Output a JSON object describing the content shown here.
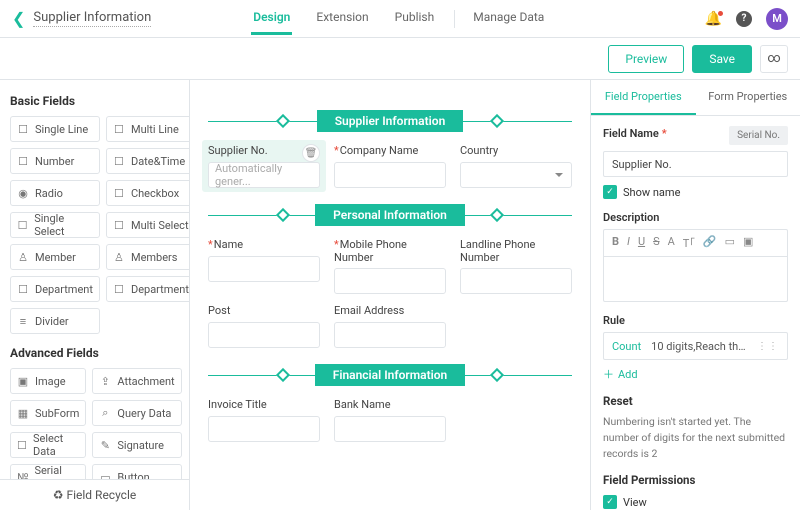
{
  "header": {
    "title": "Supplier Information",
    "tabs": [
      "Design",
      "Extension",
      "Publish"
    ],
    "manage": "Manage Data",
    "avatar": "M"
  },
  "actions": {
    "preview": "Preview",
    "save": "Save"
  },
  "sidebar": {
    "basic_title": "Basic Fields",
    "basic": [
      {
        "ic": "☐",
        "l": "Single Line"
      },
      {
        "ic": "☐",
        "l": "Multi Line"
      },
      {
        "ic": "☐",
        "l": "Number"
      },
      {
        "ic": "☐",
        "l": "Date&Time"
      },
      {
        "ic": "◉",
        "l": "Radio"
      },
      {
        "ic": "☐",
        "l": "Checkbox"
      },
      {
        "ic": "☐",
        "l": "Single Select"
      },
      {
        "ic": "☐",
        "l": "Multi Select"
      },
      {
        "ic": "♙",
        "l": "Member"
      },
      {
        "ic": "♙",
        "l": "Members"
      },
      {
        "ic": "☐",
        "l": "Department"
      },
      {
        "ic": "☐",
        "l": "Departments"
      },
      {
        "ic": "≡",
        "l": "Divider"
      }
    ],
    "adv_title": "Advanced Fields",
    "adv": [
      {
        "ic": "▣",
        "l": "Image"
      },
      {
        "ic": "⇪",
        "l": "Attachment"
      },
      {
        "ic": "▦",
        "l": "SubForm"
      },
      {
        "ic": "⌕",
        "l": "Query Data"
      },
      {
        "ic": "☐",
        "l": "Select Data"
      },
      {
        "ic": "✎",
        "l": "Signature"
      },
      {
        "ic": "№",
        "l": "Serial No."
      },
      {
        "ic": "▭",
        "l": "Button"
      }
    ],
    "recycle": "Field Recycle"
  },
  "canvas": {
    "s1": {
      "title": "Supplier Information",
      "f": [
        {
          "l": "Supplier No.",
          "ph": "Automatically gener...",
          "active": true,
          "req": false
        },
        {
          "l": "Company Name",
          "req": true
        },
        {
          "l": "Country",
          "type": "select"
        }
      ]
    },
    "s2": {
      "title": "Personal Information",
      "r1": [
        {
          "l": "Name",
          "req": true
        },
        {
          "l": "Mobile Phone Number",
          "req": true
        },
        {
          "l": "Landline Phone Number"
        }
      ],
      "r2": [
        {
          "l": "Post"
        },
        {
          "l": "Email Address"
        }
      ]
    },
    "s3": {
      "title": "Financial Information",
      "f": [
        {
          "l": "Invoice Title"
        },
        {
          "l": "Bank Name"
        }
      ]
    }
  },
  "props": {
    "tabs": [
      "Field Properties",
      "Form Properties"
    ],
    "fn_label": "Field Name",
    "badge": "Serial No.",
    "fn_value": "Supplier No.",
    "show_name": "Show name",
    "desc": "Description",
    "rule": "Rule",
    "rule_count": "Count",
    "rule_text": "10 digits,Reach the ...",
    "add": "Add",
    "reset": "Reset",
    "reset_text": "Numbering isn't started yet. The number of digits for the next submitted records is 2",
    "perm": "Field Permissions",
    "view": "View"
  }
}
